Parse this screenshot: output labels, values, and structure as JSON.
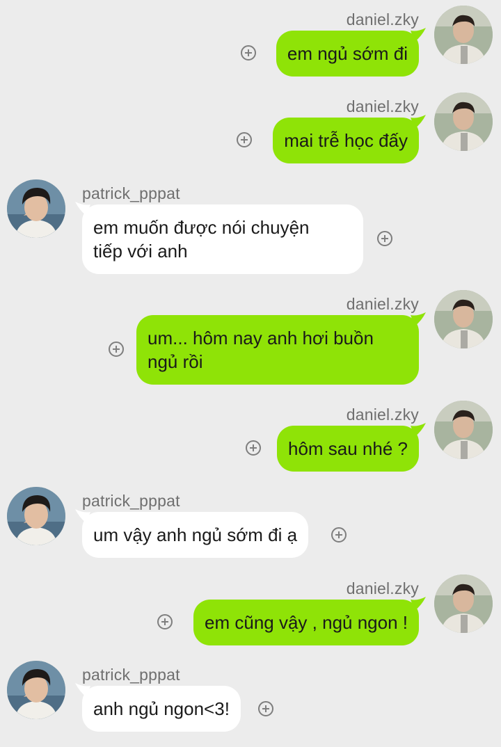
{
  "users": {
    "me": {
      "name": "daniel.zky"
    },
    "them": {
      "name": "patrick_pppat"
    }
  },
  "messages": [
    {
      "sender": "daniel.zky",
      "text": "em ngủ sớm đi"
    },
    {
      "sender": "daniel.zky",
      "text": "mai trễ học đấy"
    },
    {
      "sender": "patrick_pppat",
      "line1": "em muốn được nói chuyện",
      "line2": "tiếp với anh"
    },
    {
      "sender": "daniel.zky",
      "line1": "um... hôm nay anh hơi buồn",
      "line2": "ngủ rồi"
    },
    {
      "sender": "daniel.zky",
      "text": "hôm sau nhé ?"
    },
    {
      "sender": "patrick_pppat",
      "text": "um vậy anh ngủ sớm đi ạ"
    },
    {
      "sender": "daniel.zky",
      "text": "em cũng vậy , ngủ ngon !"
    },
    {
      "sender": "patrick_pppat",
      "text": "anh ngủ ngon<3!"
    }
  ],
  "icons": {
    "avatar": "user-avatar-icon",
    "react": "add-reaction-icon"
  },
  "colors": {
    "background": "#ececec",
    "outgoing_bubble": "#8fe307",
    "incoming_bubble": "#ffffff",
    "name_text": "#6f6f6f"
  }
}
